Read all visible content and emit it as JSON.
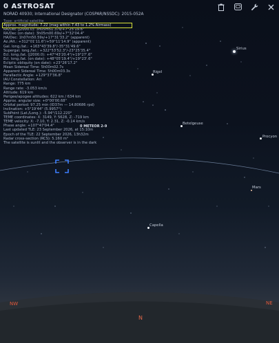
{
  "object": {
    "title": "0 ASTROSAT",
    "designator": "NORAD 40930; International Designator (COSPAR/NSSDC): 2015-052A"
  },
  "info_lines": [
    "Type: artificial satellite",
    "Approx. magnitude: 7.22 (mag within 7.43 to 1.2% Airmass)",
    "RA/Dec (J2000.0):  3h05m51.37s/+7°25'19.6\"",
    "RA/Dec (on date):  3h05m00.69s/+7°32'04.4\"",
    "HA/Dec:  1h07m50.59s/+17°31'33.2\" (apparent)",
    "Az./Alt.: +312°01'11.6\"/+59°11'14.9\" (apparent)",
    "Gal. long./lat.: +163°43'39.8\"/-35°31'49.6\"",
    "Supergal. long./lat.: +322°53'52.3\"/-23°25'35.4\"",
    "Ecl. long./lat. (J2000.0): +47°43'20.4\"/+19°27'.6\"",
    "Ecl. long./lat. (on date): +48°05'19.4\"/+19°23'.6\"",
    "Ecliptic obliquity (on date): +23°26'17.2\"",
    "Mean Sidereal Time: 5h00m02.7s",
    "Apparent Sidereal Time: 5h00m03.3s",
    "Parallactic Angle: +129°37'36.8\"",
    "IAU Constellation: Ari",
    "Range: 775 km",
    "Range rate: -3.053 km/s",
    "Altitude: 619 km",
    "Perigee/apogee altitudes: 622 km / 634 km",
    "Approx. angular size: +0°00'00.68\"",
    "Orbital period: 97.25 min (ID37m — 14.80686 rpd)",
    "Inclination: +5°19'44\" (5.9957°)",
    "SubPoint (Lat./Long.): -5.94°/112.220°",
    "TEME coordinates: X: 3149, Y: 5628, Z: -719 km",
    "TEME velocity: X: -7.10, Y: 2.31, Z: -0.14 km/s",
    "Phase angle: +107°47'04.4\"",
    "Last updated TLE: 23 September 2026, at 15:10m",
    "Epoch of the TLE: 22 September 2026, 13h32m",
    "Radar cross-section (RCS): 5.160 m²",
    "The satellite is sunlit and the observer is in the dark"
  ],
  "toolbar": {
    "delete_icon": "trash-icon",
    "window_icon": "window-icon",
    "settings_icon": "wrench-icon",
    "close_icon": "close-icon"
  },
  "stars": {
    "sirius": "Sirius",
    "rigel": "Rigel",
    "betelgeuse": "Betelgeuse",
    "procyon": "Procyon",
    "capella": "Capella"
  },
  "planets": {
    "mars": "Mars"
  },
  "markers": {
    "meteor": "0 METEOR 2-9"
  },
  "compass": {
    "nw": "NW",
    "n": "N",
    "ne": "NE"
  },
  "colors": {
    "highlight_box": "#d9e23a",
    "target_reticle": "#3d7fff",
    "cardinal": "#e35a3c"
  }
}
